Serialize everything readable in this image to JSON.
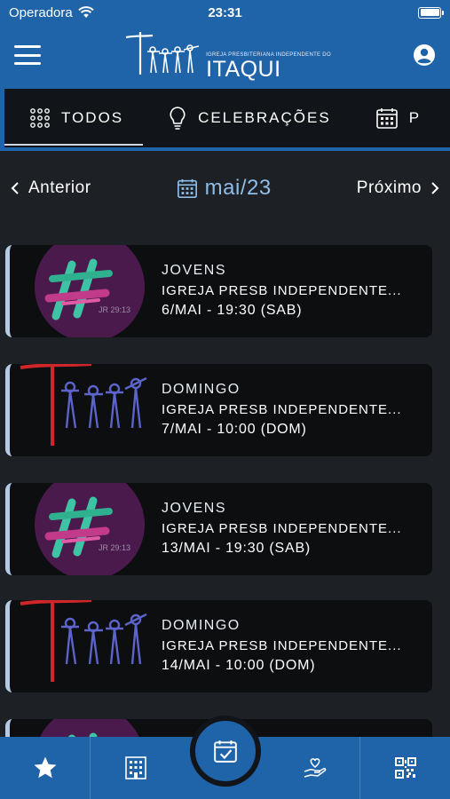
{
  "status_bar": {
    "carrier": "Operadora",
    "time": "23:31"
  },
  "header": {
    "logo_small": "IGREJA PRESBITERIANA INDEPENDENTE DO",
    "logo_main": "ITAQUI",
    "colors": {
      "bar": "#1f63a8",
      "accent": "#8fbde8"
    }
  },
  "tabs": [
    {
      "label": "TODOS",
      "icon": "grid-dots-icon",
      "active": true
    },
    {
      "label": "CELEBRAÇÕES",
      "icon": "lightbulb-icon",
      "active": false
    },
    {
      "label": "P",
      "icon": "calendar-icon",
      "active": false
    }
  ],
  "month_nav": {
    "prev_label": "Anterior",
    "current": "mai/23",
    "next_label": "Próximo"
  },
  "events": [
    {
      "title": "JOVENS",
      "venue": "IGREJA PRESB INDEPENDENTE...",
      "date": "6/MAI - 19:30 (SAB)",
      "image": "jovens-hash-logo",
      "badge": "JR 29:13"
    },
    {
      "title": "DOMINGO",
      "venue": "IGREJA PRESB INDEPENDENTE...",
      "date": "7/MAI - 10:00 (DOM)",
      "image": "church-cross-people-logo"
    },
    {
      "title": "JOVENS",
      "venue": "IGREJA PRESB INDEPENDENTE...",
      "date": "13/MAI - 19:30 (SAB)",
      "image": "jovens-hash-logo",
      "badge": "JR 29:13"
    },
    {
      "title": "DOMINGO",
      "venue": "IGREJA PRESB INDEPENDENTE...",
      "date": "14/MAI - 10:00 (DOM)",
      "image": "church-cross-people-logo"
    }
  ],
  "bottom_nav": [
    {
      "icon": "star-icon"
    },
    {
      "icon": "building-icon"
    },
    {
      "icon": "calendar-check-icon",
      "active": true
    },
    {
      "icon": "hand-heart-icon"
    },
    {
      "icon": "qr-code-icon"
    }
  ]
}
